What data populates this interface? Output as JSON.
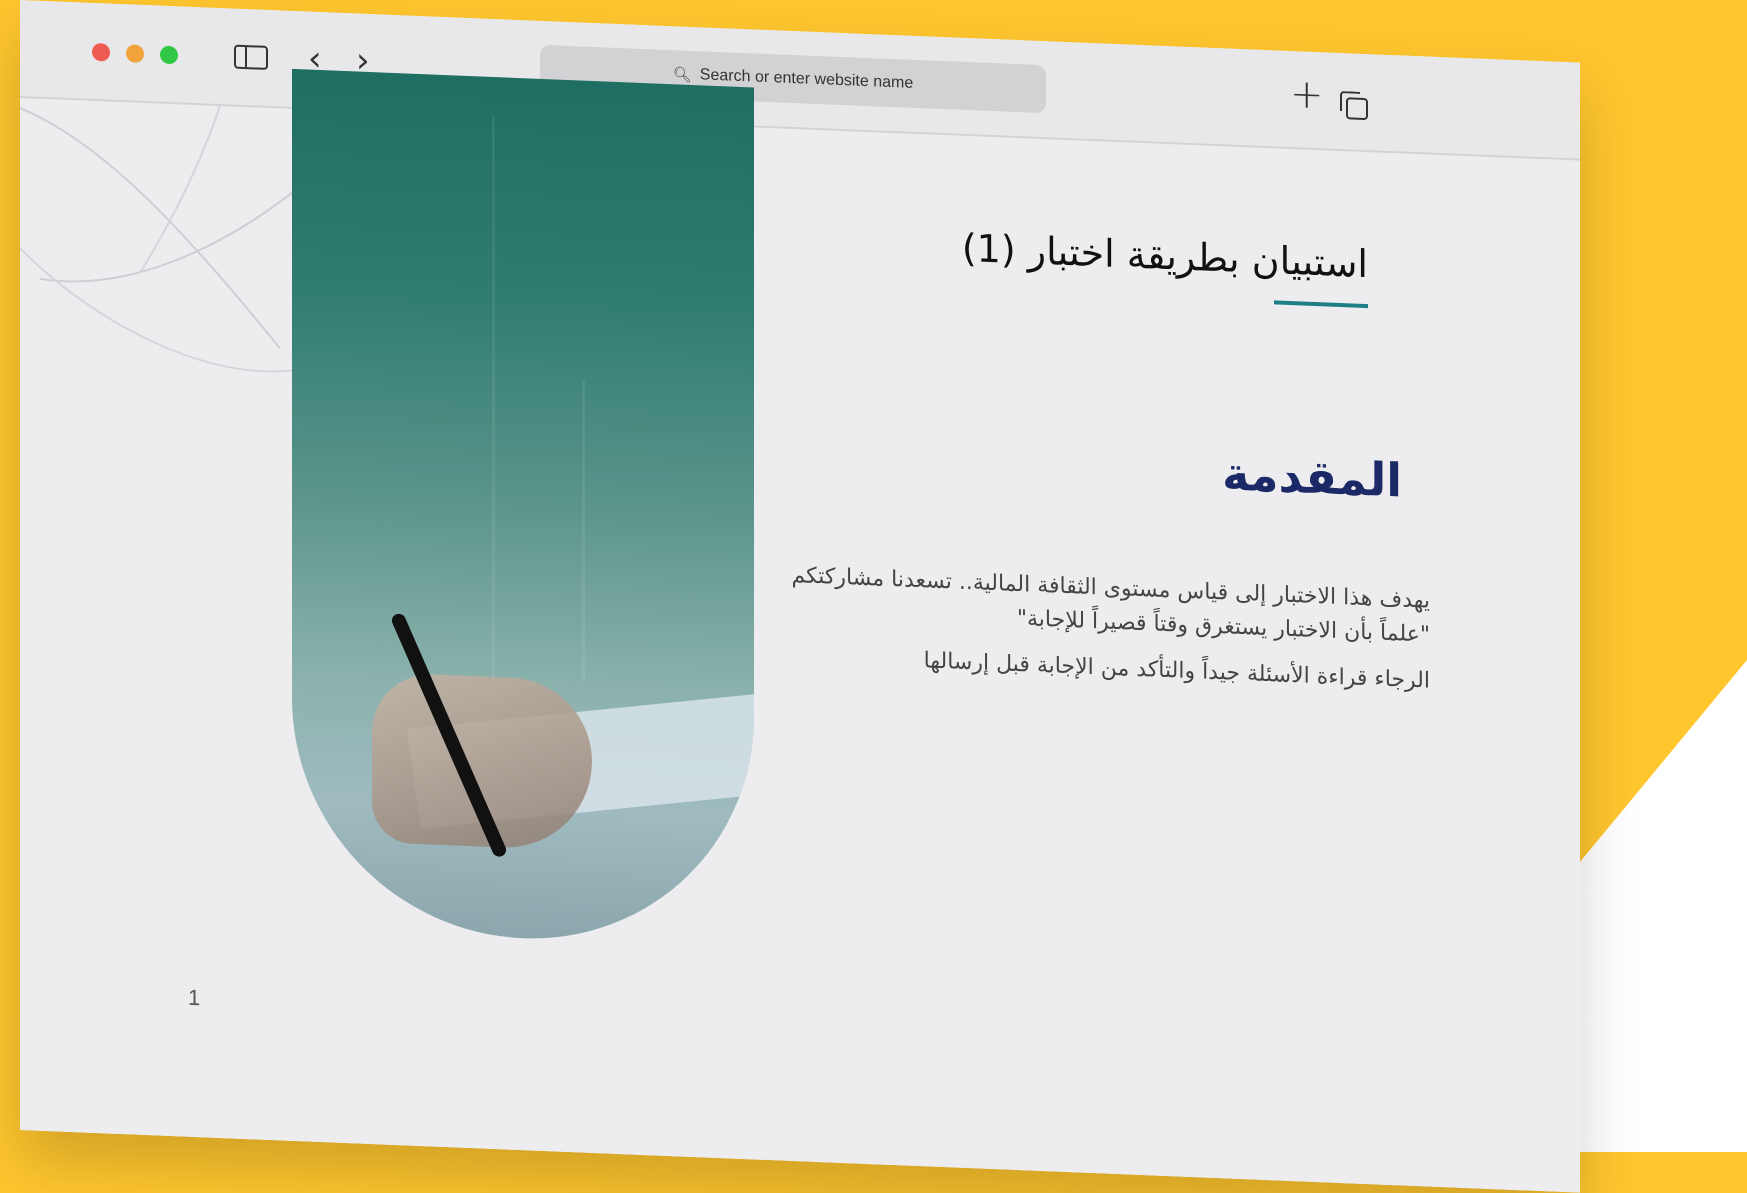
{
  "browser": {
    "url_placeholder": "Search or enter website name"
  },
  "slide": {
    "title": "استبيان بطريقة اختبار (1)",
    "section_heading": "المقدمة",
    "paragraph_1": "يهدف هذا الاختبار إلى قياس مستوى الثقافة المالية.. تسعدنا مشاركتكم \"علماً بأن الاختبار يستغرق وقتاً قصيراً للإجابة\"",
    "paragraph_2": "الرجاء قراءة الأسئلة جيداً والتأكد من الإجابة قبل إرسالها",
    "page_number": "1"
  },
  "colors": {
    "background": "#FFC62E",
    "title_underline": "#1F7F86",
    "heading": "#1B2A66",
    "photo_teal": "#1E6E61"
  }
}
